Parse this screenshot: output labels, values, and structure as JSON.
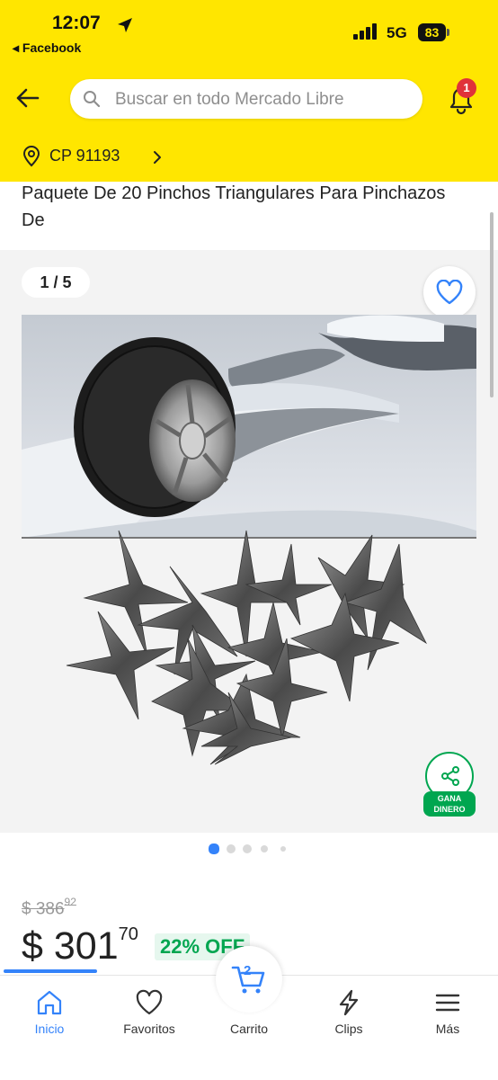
{
  "status_bar": {
    "time": "12:07",
    "back_app": "◂ Facebook",
    "network": "5G",
    "battery": "83"
  },
  "header": {
    "search_placeholder": "Buscar en todo Mercado Libre",
    "notifications_count": "1",
    "postal_code": "CP 91193"
  },
  "product": {
    "title": "Paquete De 20 Pinchos Triangulares Para Pinchazos De",
    "image_counter": "1 / 5",
    "share_label_1": "GANA",
    "share_label_2": "DINERO",
    "old_price": "$ 386",
    "old_price_cents": "92",
    "price": "$ 301",
    "price_cents": "70",
    "discount": "22% OFF"
  },
  "colors": {
    "brand_yellow": "#FFE600",
    "accent_blue": "#3483fa",
    "green": "#00a650",
    "badge_red": "#e0323a"
  },
  "bottom_nav": {
    "home": "Inicio",
    "favorites": "Favoritos",
    "cart": "Carrito",
    "cart_count": "2",
    "clips": "Clips",
    "more": "Más"
  }
}
